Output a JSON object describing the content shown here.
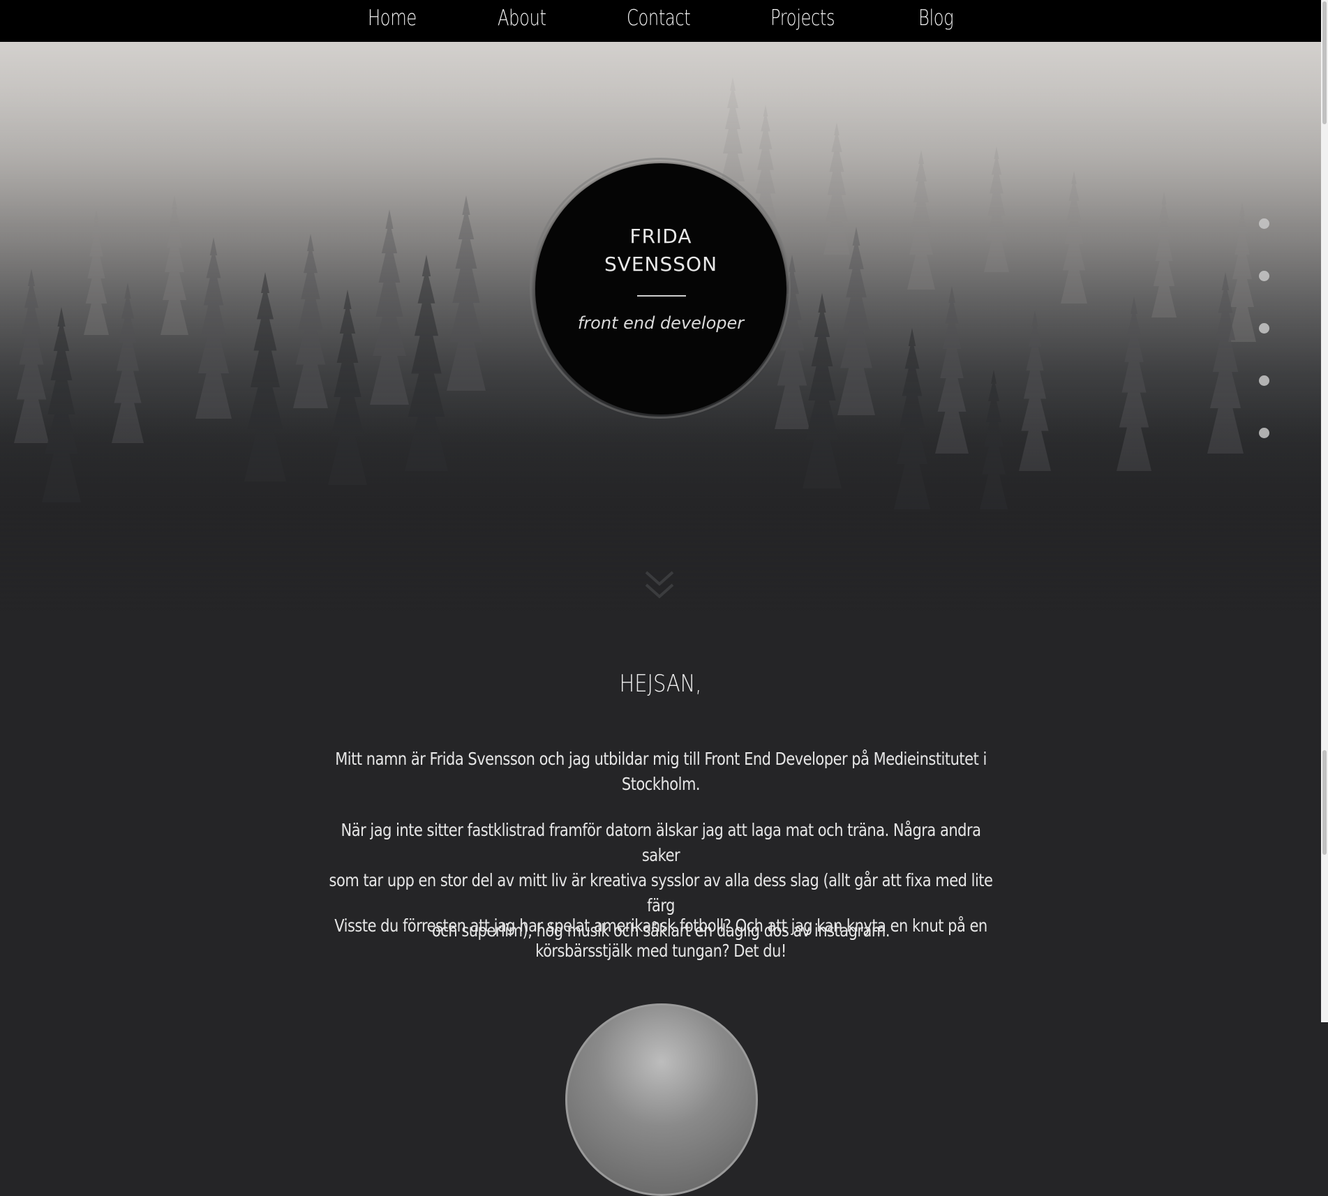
{
  "nav": {
    "items": [
      {
        "label": "Home"
      },
      {
        "label": "About"
      },
      {
        "label": "Contact"
      },
      {
        "label": "Projects"
      },
      {
        "label": "Blog"
      }
    ]
  },
  "hero": {
    "name_first": "FRIDA",
    "name_last": "SVENSSON",
    "role": "front end developer",
    "section_dots": 5
  },
  "intro": {
    "title": "HEJSAN,",
    "paragraphs": [
      {
        "lines": [
          "Mitt namn är Frida Svensson och jag utbildar mig till Front End Developer på Medieinstitutet i",
          "Stockholm."
        ]
      },
      {
        "lines": [
          "När jag inte sitter fastklistrad framför datorn älskar jag att laga mat och träna. Några andra saker",
          "som tar upp en stor del av mitt liv är kreativa sysslor av alla dess slag (allt går att fixa med lite färg",
          "och superlim), hög musik och såklart en daglig dos av instagram."
        ]
      },
      {
        "lines": [
          "Visste du förresten att jag har spelat amerikansk fotboll? Och att jag kan knyta en knut på en",
          "körsbärsstjälk med tungan? Det du!"
        ]
      }
    ]
  },
  "colors": {
    "nav_bg": "#000000",
    "page_bg": "#252527",
    "circle_bg": "#050505",
    "text": "#ececec"
  }
}
